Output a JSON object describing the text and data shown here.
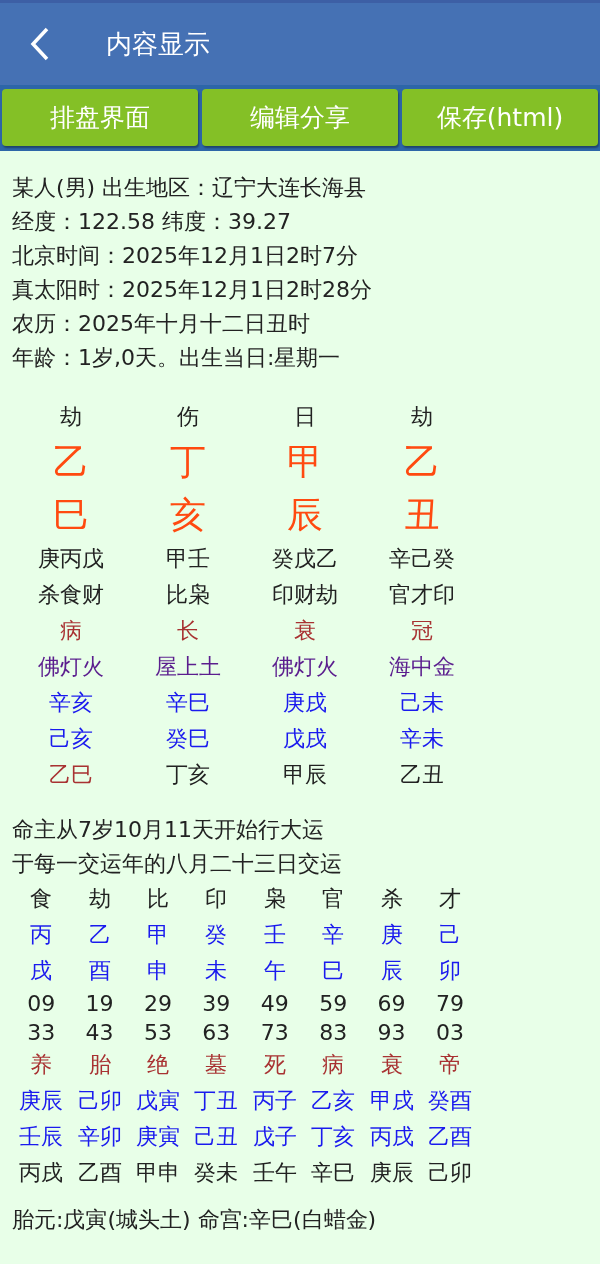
{
  "header": {
    "title": "内容显示"
  },
  "buttons": [
    "排盘界面",
    "编辑分享",
    "保存(html)"
  ],
  "info_lines": [
    "某人(男) 出生地区：辽宁大连长海县",
    "经度：122.58 纬度：39.27",
    "北京时间：2025年12月1日2时7分",
    "真太阳时：2025年12月1日2时28分",
    "农历：2025年十月十二日丑时",
    "年龄：1岁,0天。出生当日:星期一"
  ],
  "pillars": [
    {
      "kind": "label",
      "cells": [
        {
          "text": "劫",
          "color": "#222222"
        },
        {
          "text": "伤",
          "color": "#222222"
        },
        {
          "text": "日",
          "color": "#222222"
        },
        {
          "text": "劫",
          "color": "#222222"
        }
      ]
    },
    {
      "kind": "big",
      "cells": [
        {
          "text": "乙",
          "color": "#ff4a10"
        },
        {
          "text": "丁",
          "color": "#ff4a10"
        },
        {
          "text": "甲",
          "color": "#ff4a10"
        },
        {
          "text": "乙",
          "color": "#ff4a10"
        }
      ]
    },
    {
      "kind": "big",
      "cells": [
        {
          "text": "巳",
          "color": "#ff4a10"
        },
        {
          "text": "亥",
          "color": "#ff4a10"
        },
        {
          "text": "辰",
          "color": "#ff4a10"
        },
        {
          "text": "丑",
          "color": "#ff4a10"
        }
      ]
    },
    {
      "kind": "normal",
      "cells": [
        {
          "text": "庚丙戊",
          "color": "#222222"
        },
        {
          "text": "甲壬",
          "color": "#222222"
        },
        {
          "text": "癸戊乙",
          "color": "#222222"
        },
        {
          "text": "辛己癸",
          "color": "#222222"
        }
      ]
    },
    {
      "kind": "normal",
      "cells": [
        {
          "text": "杀食财",
          "color": "#222222"
        },
        {
          "text": "比枭",
          "color": "#222222"
        },
        {
          "text": "印财劫",
          "color": "#222222"
        },
        {
          "text": "官才印",
          "color": "#222222"
        }
      ]
    },
    {
      "kind": "normal",
      "cells": [
        {
          "text": "病",
          "color": "#a83232"
        },
        {
          "text": "长",
          "color": "#a83232"
        },
        {
          "text": "衰",
          "color": "#a83232"
        },
        {
          "text": "冠",
          "color": "#a83232"
        }
      ]
    },
    {
      "kind": "normal",
      "cells": [
        {
          "text": "佛灯火",
          "color": "#5b1e8e"
        },
        {
          "text": "屋上土",
          "color": "#5b1e8e"
        },
        {
          "text": "佛灯火",
          "color": "#5b1e8e"
        },
        {
          "text": "海中金",
          "color": "#5b1e8e"
        }
      ]
    },
    {
      "kind": "normal",
      "cells": [
        {
          "text": "辛亥",
          "color": "#1a1aee"
        },
        {
          "text": "辛巳",
          "color": "#1a1aee"
        },
        {
          "text": "庚戌",
          "color": "#1a1aee"
        },
        {
          "text": "己未",
          "color": "#1a1aee"
        }
      ]
    },
    {
      "kind": "normal",
      "cells": [
        {
          "text": "己亥",
          "color": "#1a1aee"
        },
        {
          "text": "癸巳",
          "color": "#1a1aee"
        },
        {
          "text": "戊戌",
          "color": "#1a1aee"
        },
        {
          "text": "辛未",
          "color": "#1a1aee"
        }
      ]
    },
    {
      "kind": "normal",
      "cells": [
        {
          "text": "乙巳",
          "color": "#a83232"
        },
        {
          "text": "丁亥",
          "color": "#222222"
        },
        {
          "text": "甲辰",
          "color": "#222222"
        },
        {
          "text": "乙丑",
          "color": "#222222"
        }
      ]
    }
  ],
  "dayun_intro": [
    "命主从7岁10月11天开始行大运",
    "于每一交运年的八月二十三日交运"
  ],
  "dayun": [
    {
      "kind": "normal",
      "cells": [
        {
          "text": "食",
          "color": "#222222"
        },
        {
          "text": "劫",
          "color": "#222222"
        },
        {
          "text": "比",
          "color": "#222222"
        },
        {
          "text": "印",
          "color": "#222222"
        },
        {
          "text": "枭",
          "color": "#222222"
        },
        {
          "text": "官",
          "color": "#222222"
        },
        {
          "text": "杀",
          "color": "#222222"
        },
        {
          "text": "才",
          "color": "#222222"
        }
      ]
    },
    {
      "kind": "normal",
      "cells": [
        {
          "text": "丙",
          "color": "#1a1aee"
        },
        {
          "text": "乙",
          "color": "#1a1aee"
        },
        {
          "text": "甲",
          "color": "#1a1aee"
        },
        {
          "text": "癸",
          "color": "#1a1aee"
        },
        {
          "text": "壬",
          "color": "#1a1aee"
        },
        {
          "text": "辛",
          "color": "#1a1aee"
        },
        {
          "text": "庚",
          "color": "#1a1aee"
        },
        {
          "text": "己",
          "color": "#1a1aee"
        }
      ]
    },
    {
      "kind": "normal",
      "cells": [
        {
          "text": "戌",
          "color": "#1a1aee"
        },
        {
          "text": "酉",
          "color": "#1a1aee"
        },
        {
          "text": "申",
          "color": "#1a1aee"
        },
        {
          "text": "未",
          "color": "#1a1aee"
        },
        {
          "text": "午",
          "color": "#1a1aee"
        },
        {
          "text": "巳",
          "color": "#1a1aee"
        },
        {
          "text": "辰",
          "color": "#1a1aee"
        },
        {
          "text": "卯",
          "color": "#1a1aee"
        }
      ]
    },
    {
      "kind": "number",
      "cells": [
        {
          "text": "09",
          "color": "#222222"
        },
        {
          "text": "19",
          "color": "#222222"
        },
        {
          "text": "29",
          "color": "#222222"
        },
        {
          "text": "39",
          "color": "#222222"
        },
        {
          "text": "49",
          "color": "#222222"
        },
        {
          "text": "59",
          "color": "#222222"
        },
        {
          "text": "69",
          "color": "#222222"
        },
        {
          "text": "79",
          "color": "#222222"
        }
      ]
    },
    {
      "kind": "number",
      "cells": [
        {
          "text": "33",
          "color": "#222222"
        },
        {
          "text": "43",
          "color": "#222222"
        },
        {
          "text": "53",
          "color": "#222222"
        },
        {
          "text": "63",
          "color": "#222222"
        },
        {
          "text": "73",
          "color": "#222222"
        },
        {
          "text": "83",
          "color": "#222222"
        },
        {
          "text": "93",
          "color": "#222222"
        },
        {
          "text": "03",
          "color": "#222222"
        }
      ]
    },
    {
      "kind": "normal",
      "cells": [
        {
          "text": "养",
          "color": "#a83232"
        },
        {
          "text": "胎",
          "color": "#a83232"
        },
        {
          "text": "绝",
          "color": "#a83232"
        },
        {
          "text": "墓",
          "color": "#a83232"
        },
        {
          "text": "死",
          "color": "#a83232"
        },
        {
          "text": "病",
          "color": "#a83232"
        },
        {
          "text": "衰",
          "color": "#a83232"
        },
        {
          "text": "帝",
          "color": "#a83232"
        }
      ]
    },
    {
      "kind": "normal",
      "cells": [
        {
          "text": "庚辰",
          "color": "#1a1aee"
        },
        {
          "text": "己卯",
          "color": "#1a1aee"
        },
        {
          "text": "戊寅",
          "color": "#1a1aee"
        },
        {
          "text": "丁丑",
          "color": "#1a1aee"
        },
        {
          "text": "丙子",
          "color": "#1a1aee"
        },
        {
          "text": "乙亥",
          "color": "#1a1aee"
        },
        {
          "text": "甲戌",
          "color": "#1a1aee"
        },
        {
          "text": "癸酉",
          "color": "#1a1aee"
        }
      ]
    },
    {
      "kind": "normal",
      "cells": [
        {
          "text": "壬辰",
          "color": "#1a1aee"
        },
        {
          "text": "辛卯",
          "color": "#1a1aee"
        },
        {
          "text": "庚寅",
          "color": "#1a1aee"
        },
        {
          "text": "己丑",
          "color": "#1a1aee"
        },
        {
          "text": "戊子",
          "color": "#1a1aee"
        },
        {
          "text": "丁亥",
          "color": "#1a1aee"
        },
        {
          "text": "丙戌",
          "color": "#1a1aee"
        },
        {
          "text": "乙酉",
          "color": "#1a1aee"
        }
      ]
    },
    {
      "kind": "normal",
      "cells": [
        {
          "text": "丙戌",
          "color": "#222222"
        },
        {
          "text": "乙酉",
          "color": "#222222"
        },
        {
          "text": "甲申",
          "color": "#222222"
        },
        {
          "text": "癸未",
          "color": "#222222"
        },
        {
          "text": "壬午",
          "color": "#222222"
        },
        {
          "text": "辛巳",
          "color": "#222222"
        },
        {
          "text": "庚辰",
          "color": "#222222"
        },
        {
          "text": "己卯",
          "color": "#222222"
        }
      ]
    }
  ],
  "footer": "胎元:戊寅(城头土) 命宫:辛巳(白蜡金)"
}
